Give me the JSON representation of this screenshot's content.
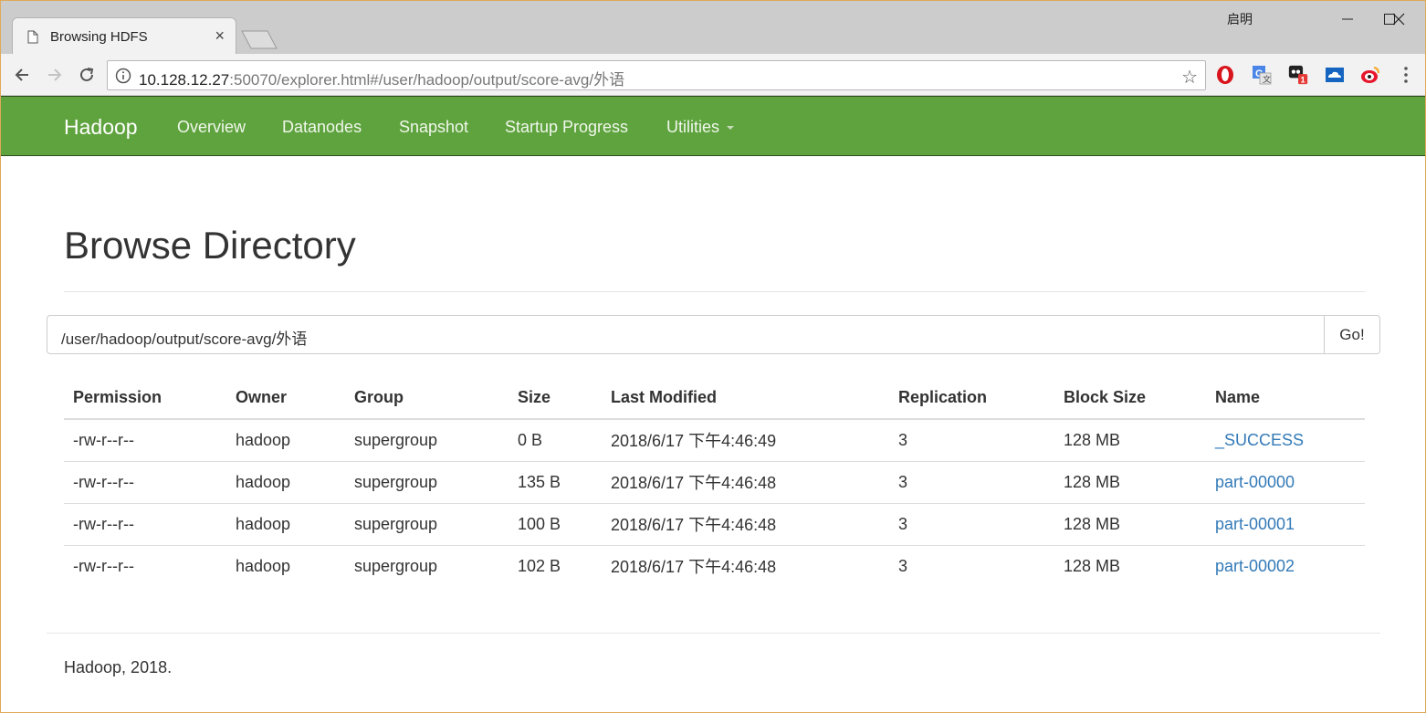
{
  "browser": {
    "tab_title": "Browsing HDFS",
    "tab_close": "×",
    "user_name": "启明",
    "url_host": "10.128.12.27",
    "url_rest": ":50070/explorer.html#/user/hadoop/output/score-avg/外语",
    "star": "☆",
    "extensions": [
      "opera-icon",
      "translate-icon",
      "badge-extension-icon",
      "cloud-extension-icon",
      "weibo-icon"
    ],
    "extension_badge": "1"
  },
  "navbar": {
    "brand": "Hadoop",
    "links": [
      "Overview",
      "Datanodes",
      "Snapshot",
      "Startup Progress",
      "Utilities"
    ],
    "color": "#5fa33e"
  },
  "page": {
    "title": "Browse Directory",
    "path_value": "/user/hadoop/output/score-avg/外语",
    "go_label": "Go!",
    "footer": "Hadoop, 2018."
  },
  "table": {
    "headers": [
      "Permission",
      "Owner",
      "Group",
      "Size",
      "Last Modified",
      "Replication",
      "Block Size",
      "Name"
    ],
    "rows": [
      [
        "-rw-r--r--",
        "hadoop",
        "supergroup",
        "0 B",
        "2018/6/17 下午4:46:49",
        "3",
        "128 MB",
        "_SUCCESS"
      ],
      [
        "-rw-r--r--",
        "hadoop",
        "supergroup",
        "135 B",
        "2018/6/17 下午4:46:48",
        "3",
        "128 MB",
        "part-00000"
      ],
      [
        "-rw-r--r--",
        "hadoop",
        "supergroup",
        "100 B",
        "2018/6/17 下午4:46:48",
        "3",
        "128 MB",
        "part-00001"
      ],
      [
        "-rw-r--r--",
        "hadoop",
        "supergroup",
        "102 B",
        "2018/6/17 下午4:46:48",
        "3",
        "128 MB",
        "part-00002"
      ]
    ],
    "link_color": "#337ab7"
  }
}
